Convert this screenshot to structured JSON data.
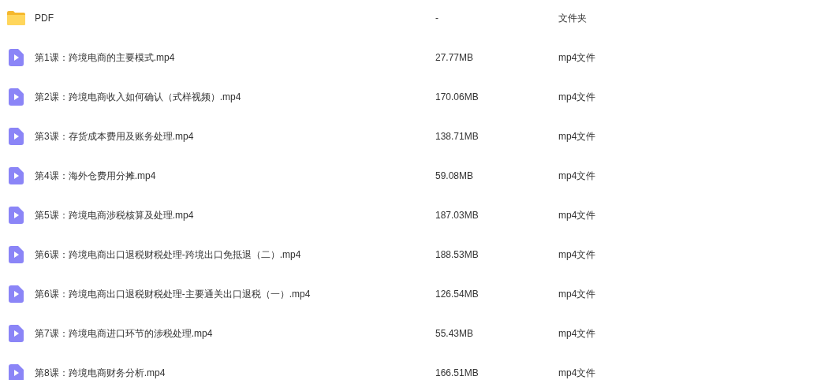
{
  "files": [
    {
      "kind": "folder",
      "name": "PDF",
      "size": "-",
      "type": "文件夹"
    },
    {
      "kind": "video",
      "name": "第1课：跨境电商的主要模式.mp4",
      "size": "27.77MB",
      "type": "mp4文件"
    },
    {
      "kind": "video",
      "name": "第2课：跨境电商收入如何确认（式样视频）.mp4",
      "size": "170.06MB",
      "type": "mp4文件"
    },
    {
      "kind": "video",
      "name": "第3课：存货成本费用及账务处理.mp4",
      "size": "138.71MB",
      "type": "mp4文件"
    },
    {
      "kind": "video",
      "name": "第4课：海外仓费用分摊.mp4",
      "size": "59.08MB",
      "type": "mp4文件"
    },
    {
      "kind": "video",
      "name": "第5课：跨境电商涉税核算及处理.mp4",
      "size": "187.03MB",
      "type": "mp4文件"
    },
    {
      "kind": "video",
      "name": "第6课：跨境电商出口退税财税处理-跨境出口免抵退（二）.mp4",
      "size": "188.53MB",
      "type": "mp4文件"
    },
    {
      "kind": "video",
      "name": "第6课：跨境电商出口退税财税处理-主要通关出口退税（一）.mp4",
      "size": "126.54MB",
      "type": "mp4文件"
    },
    {
      "kind": "video",
      "name": "第7课：跨境电商进口环节的涉税处理.mp4",
      "size": "55.43MB",
      "type": "mp4文件"
    },
    {
      "kind": "video",
      "name": "第8课：跨境电商财务分析.mp4",
      "size": "166.51MB",
      "type": "mp4文件"
    }
  ]
}
